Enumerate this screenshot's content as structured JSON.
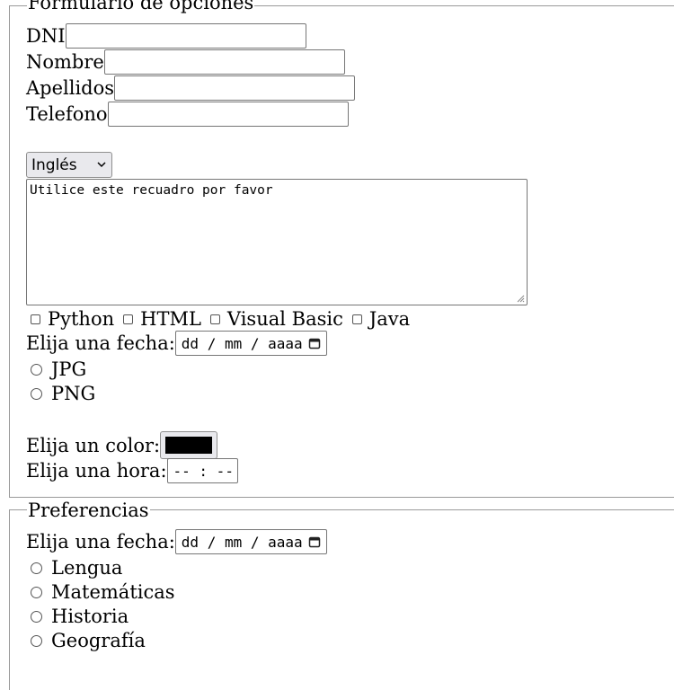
{
  "form": {
    "legend": "Formulario de opciones",
    "fields": [
      {
        "label": "DNI",
        "value": ""
      },
      {
        "label": "Nombre",
        "value": ""
      },
      {
        "label": "Apellidos",
        "value": ""
      },
      {
        "label": "Telefono",
        "value": ""
      }
    ],
    "language_select": {
      "selected": "Inglés"
    },
    "textarea_text": "Utilice este recuadro por favor",
    "checkboxes": [
      "Python",
      "HTML",
      "Visual Basic",
      "Java"
    ],
    "date_label": "Elija una fecha:",
    "date_placeholder": "dd / mm / aaaa",
    "radios": [
      "JPG",
      "PNG"
    ],
    "color_label": "Elija un color:",
    "color_value": "#000000",
    "time_label": "Elija una hora:",
    "time_placeholder": "-- : --"
  },
  "prefs": {
    "legend": "Preferencias",
    "date_label": "Elija una fecha:",
    "date_placeholder": "dd / mm / aaaa",
    "radios": [
      "Lengua",
      "Matemáticas",
      "Historia",
      "Geografía"
    ]
  }
}
